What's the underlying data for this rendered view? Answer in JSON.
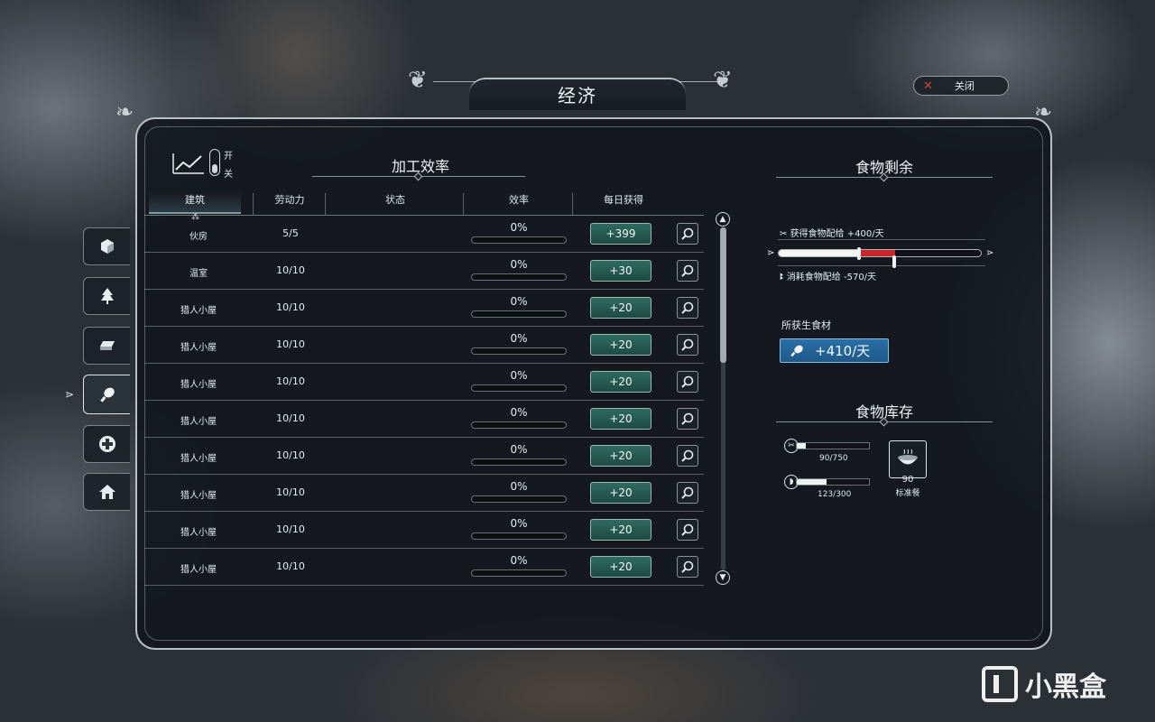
{
  "header": {
    "title": "经济",
    "close_label": "关闭"
  },
  "side_tabs": [
    {
      "icon": "resource-cube-icon"
    },
    {
      "icon": "tree-icon"
    },
    {
      "icon": "steel-ingot-icon"
    },
    {
      "icon": "food-drumstick-icon",
      "active": true
    },
    {
      "icon": "health-cross-icon"
    },
    {
      "icon": "house-icon"
    }
  ],
  "trend": {
    "on_label": "开",
    "off_label": "关"
  },
  "production": {
    "heading": "加工效率",
    "columns": [
      "建筑",
      "劳动力",
      "状态",
      "效率",
      "每日获得"
    ],
    "rows": [
      {
        "building": "伙房",
        "workers": "5/5",
        "efficiency": "0%",
        "gain": "+399"
      },
      {
        "building": "温室",
        "workers": "10/10",
        "efficiency": "0%",
        "gain": "+30"
      },
      {
        "building": "猎人小屋",
        "workers": "10/10",
        "efficiency": "0%",
        "gain": "+20"
      },
      {
        "building": "猎人小屋",
        "workers": "10/10",
        "efficiency": "0%",
        "gain": "+20"
      },
      {
        "building": "猎人小屋",
        "workers": "10/10",
        "efficiency": "0%",
        "gain": "+20"
      },
      {
        "building": "猎人小屋",
        "workers": "10/10",
        "efficiency": "0%",
        "gain": "+20"
      },
      {
        "building": "猎人小屋",
        "workers": "10/10",
        "efficiency": "0%",
        "gain": "+20"
      },
      {
        "building": "猎人小屋",
        "workers": "10/10",
        "efficiency": "0%",
        "gain": "+20"
      },
      {
        "building": "猎人小屋",
        "workers": "10/10",
        "efficiency": "0%",
        "gain": "+20"
      },
      {
        "building": "猎人小屋",
        "workers": "10/10",
        "efficiency": "0%",
        "gain": "+20"
      }
    ]
  },
  "food_surplus": {
    "heading": "食物剩余",
    "gain_text": "获得食物配给 +400/天",
    "consume_text": "消耗食物配给 -570/天",
    "gain_fraction": 0.4,
    "consume_fraction": 0.57,
    "colors": {
      "gain": "#f2f4f5",
      "deficit": "#c8242a"
    }
  },
  "raw_food": {
    "label": "所获生食材",
    "value": "+410/天"
  },
  "food_stock": {
    "heading": "食物库存",
    "rations": {
      "value": "90/750",
      "fraction": 0.12
    },
    "raw": {
      "value": "123/300",
      "fraction": 0.41
    },
    "meal": {
      "count": "90",
      "label": "标准餐"
    }
  },
  "watermark": {
    "text": "小黑盒"
  }
}
